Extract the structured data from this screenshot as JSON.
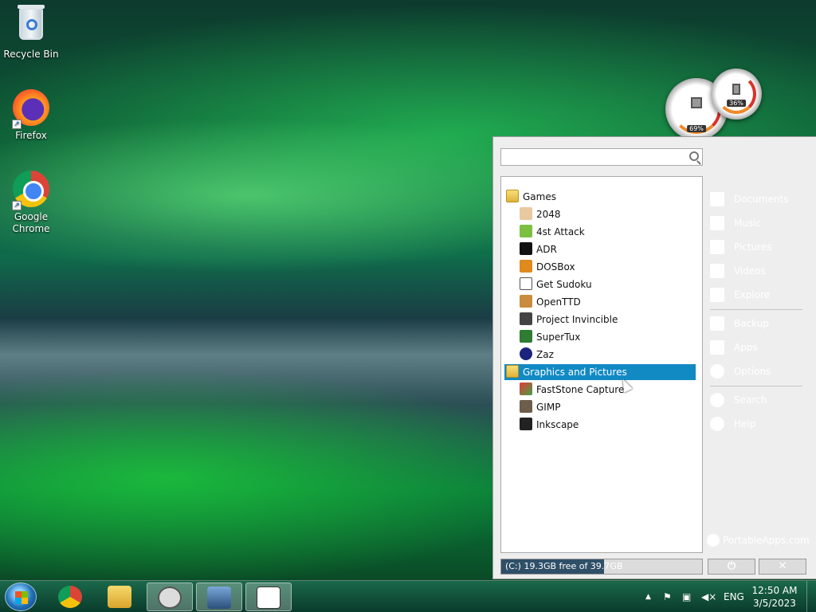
{
  "desktop": {
    "icons": [
      {
        "label": "Recycle Bin",
        "icon": "recycle-bin-icon"
      },
      {
        "label": "Firefox",
        "icon": "firefox-icon"
      },
      {
        "label": "Google Chrome",
        "icon": "chrome-icon"
      }
    ]
  },
  "gadgets": {
    "cpu_gauge": {
      "value": "69%"
    },
    "memory_gauge": {
      "value": "36%"
    }
  },
  "portableapps": {
    "search": {
      "placeholder": "",
      "value": ""
    },
    "categories": [
      {
        "label": "Games",
        "apps": [
          "2048",
          "4st Attack",
          "ADR",
          "DOSBox",
          "Get Sudoku",
          "OpenTTD",
          "Project Invincible",
          "SuperTux",
          "Zaz"
        ]
      },
      {
        "label": "Graphics and Pictures",
        "selected": true,
        "apps": [
          "FastStone Capture",
          "GIMP",
          "Inkscape"
        ]
      }
    ],
    "right_menu": {
      "group1": [
        "Documents",
        "Music",
        "Pictures",
        "Videos",
        "Explore"
      ],
      "group2": [
        "Backup",
        "Apps",
        "Options"
      ],
      "group3": [
        "Search",
        "Help"
      ]
    },
    "brand": "PortableApps.com",
    "disk": {
      "label": "(C:) 19.3GB free of 39.7GB",
      "used_fraction": 0.51
    },
    "power_button": "⏻",
    "close_button": "✕"
  },
  "taskbar": {
    "pinned": [
      "chrome",
      "file-explorer",
      "portableapps",
      "chess",
      "solitaire"
    ],
    "tray": {
      "language": "ENG",
      "time": "12:50 AM",
      "date": "3/5/2023",
      "show_hidden": "▲"
    }
  },
  "colors": {
    "selection": "#118ac4",
    "menu_bg": "#eeeeee"
  }
}
